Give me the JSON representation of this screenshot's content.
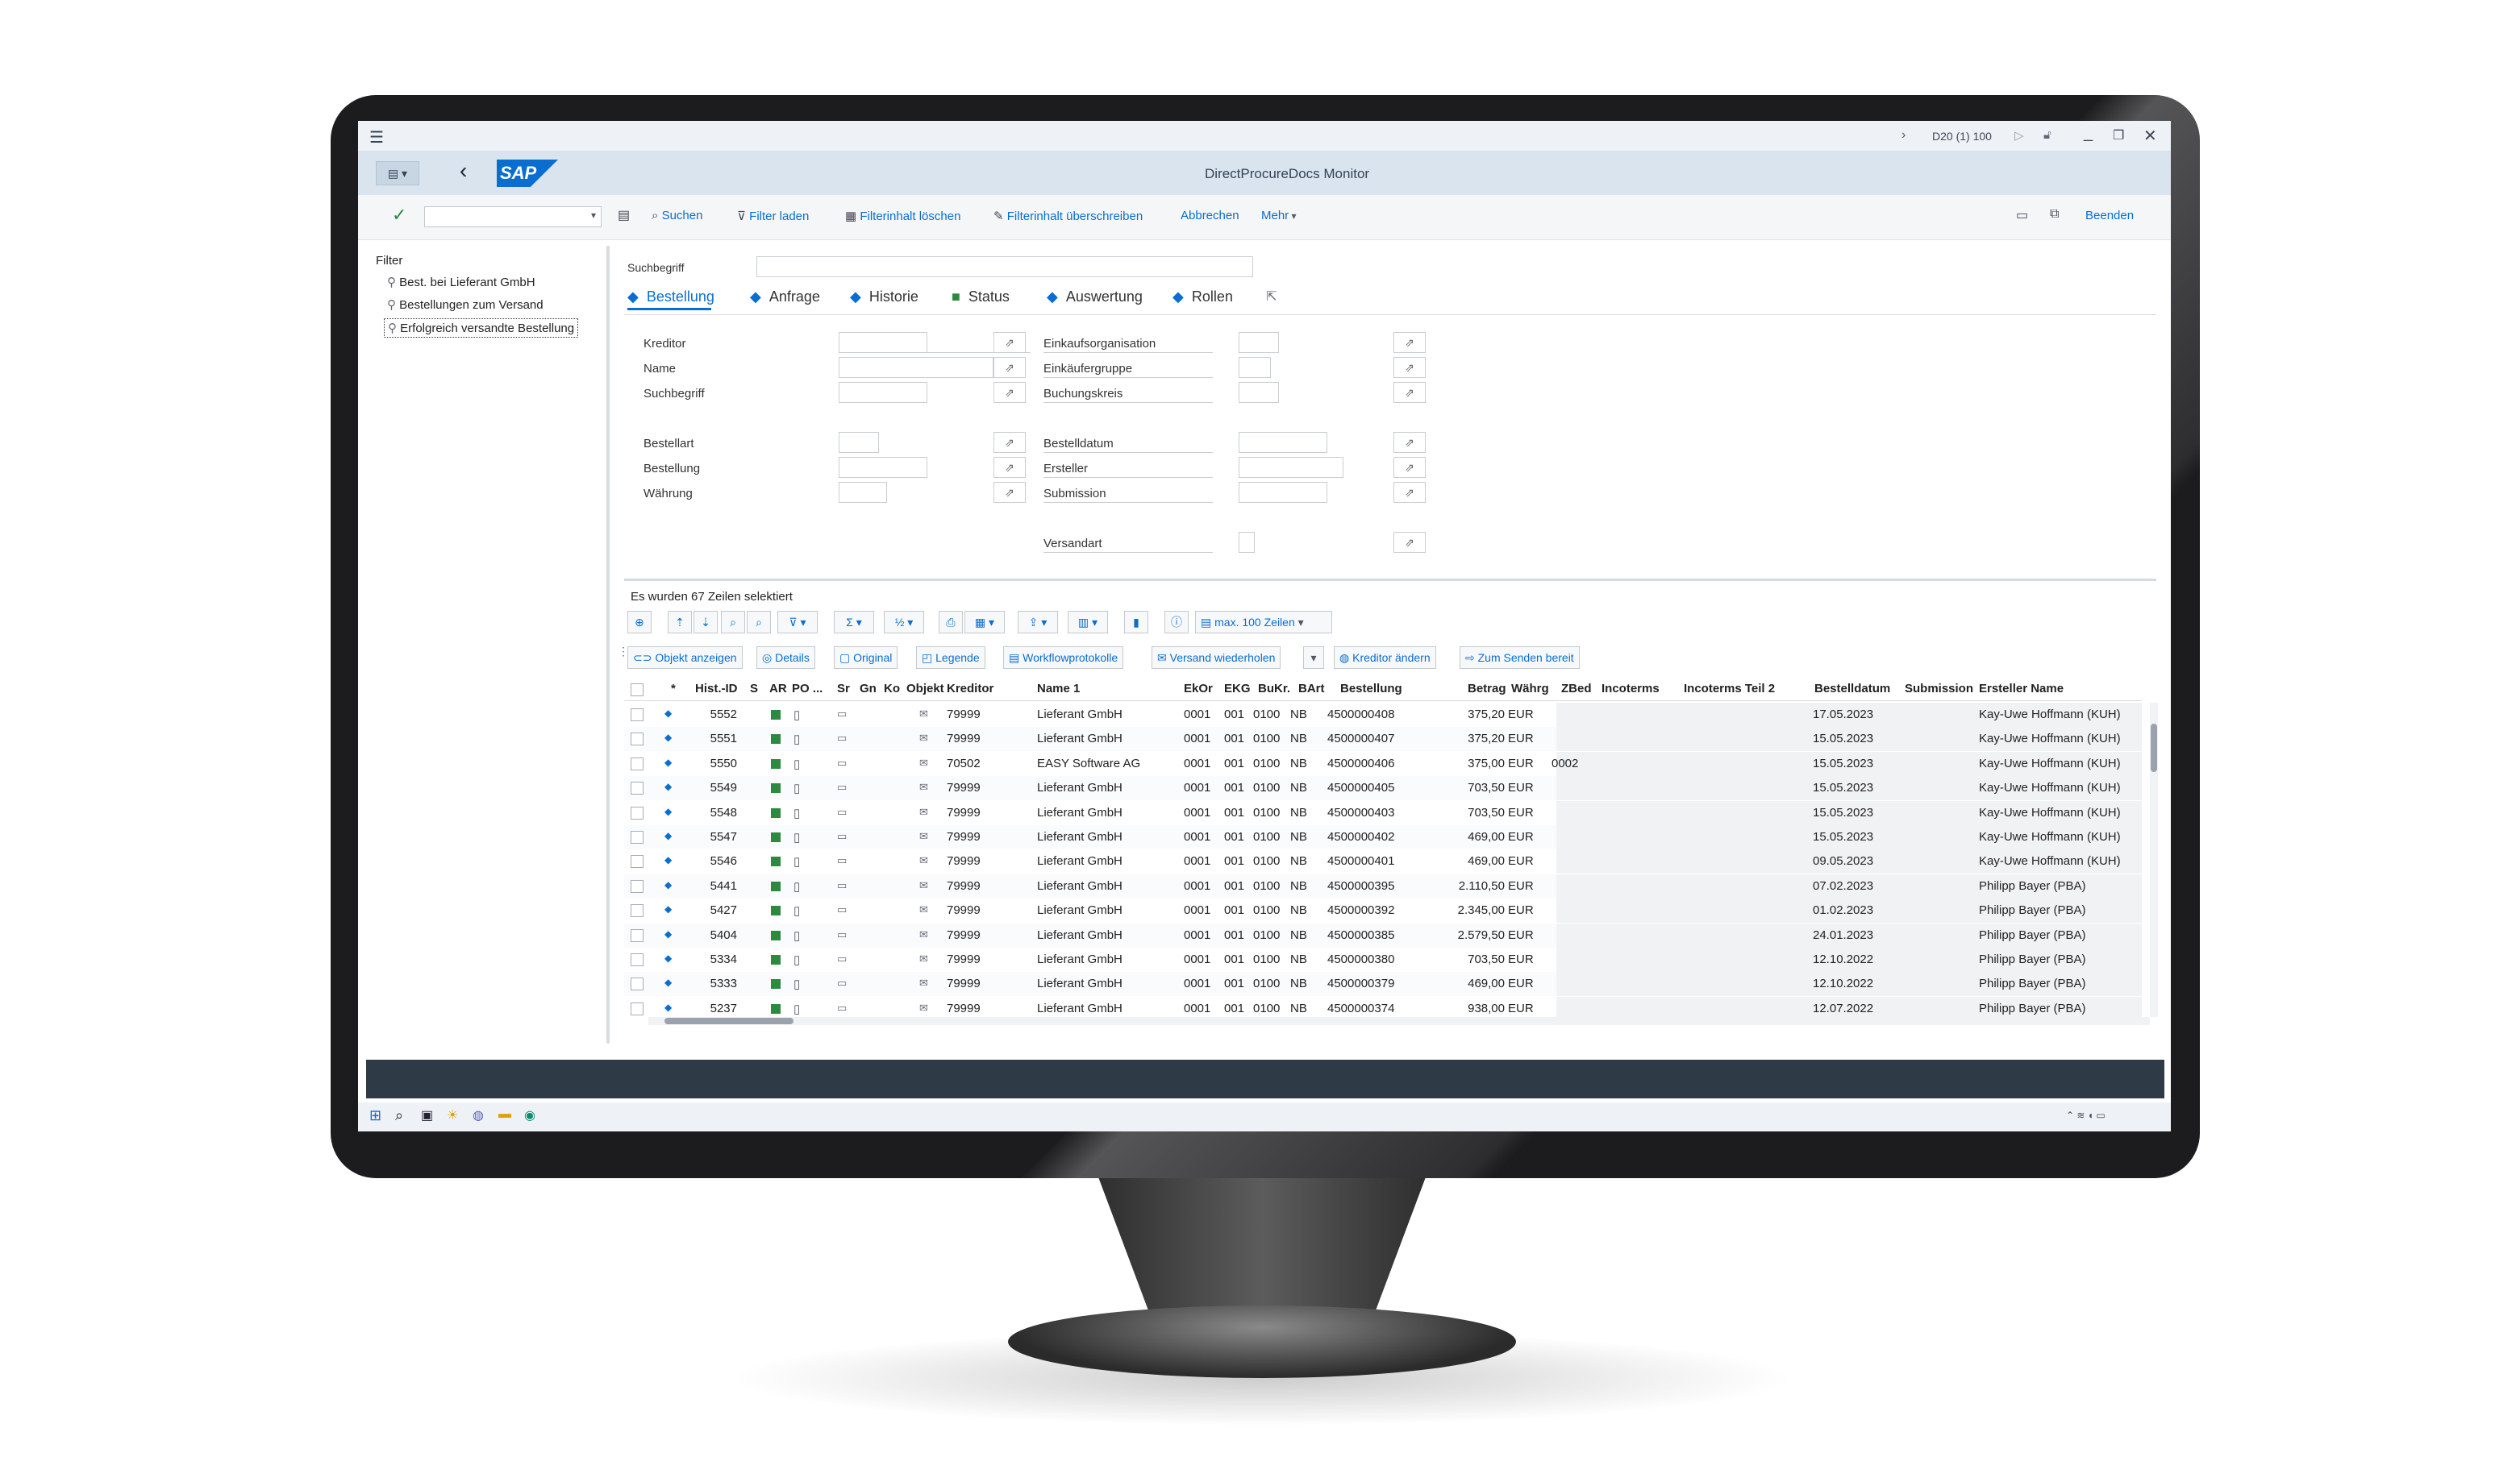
{
  "window": {
    "session": "D20 (1) 100",
    "title": "DirectProcureDocs Monitor",
    "logo": "SAP"
  },
  "toolbar": {
    "items": [
      "Suchen",
      "Filter laden",
      "Filterinhalt löschen",
      "Filterinhalt überschreiben",
      "Abbrechen",
      "Mehr"
    ],
    "exit": "Beenden"
  },
  "filter": {
    "title": "Filter",
    "items": [
      "Best. bei Lieferant GmbH",
      "Bestellungen zum Versand",
      "Erfolgreich versandte Bestellung"
    ]
  },
  "search": {
    "label": "Suchbegriff",
    "value": ""
  },
  "tabs": [
    {
      "label": "Bestellung",
      "marker": "◆",
      "active": true
    },
    {
      "label": "Anfrage",
      "marker": "◆"
    },
    {
      "label": "Historie",
      "marker": "◆"
    },
    {
      "label": "Status",
      "marker": "■"
    },
    {
      "label": "Auswertung",
      "marker": "◆"
    },
    {
      "label": "Rollen",
      "marker": "◆"
    }
  ],
  "form": {
    "left": [
      "Kreditor",
      "Name",
      "Suchbegriff",
      "Bestellart",
      "Bestellung",
      "Währung"
    ],
    "right": [
      "Einkaufsorganisation",
      "Einkäufergruppe",
      "Buchungskreis",
      "Bestelldatum",
      "Ersteller",
      "Submission",
      "Versandart"
    ]
  },
  "result": {
    "count_text": "Es wurden 67 Zeilen selektiert",
    "max_rows": "max. 100 Zeilen",
    "actions": [
      "Objekt anzeigen",
      "Details",
      "Original",
      "Legende",
      "Workflowprotokolle",
      "Versand wiederholen",
      "Kreditor ändern",
      "Zum Senden bereit"
    ]
  },
  "table": {
    "columns": [
      "*",
      "Hist.-ID",
      "S",
      "AR",
      "PO ...",
      "Sr",
      "Gn",
      "Ko",
      "Objekt",
      "Kreditor",
      "Name 1",
      "EkOr",
      "EKG",
      "BuKr.",
      "BArt",
      "Bestellung",
      "Betrag",
      "Währg",
      "ZBed",
      "Incoterms",
      "Incoterms Teil 2",
      "Bestelldatum",
      "Submission",
      "Ersteller Name"
    ],
    "rows": [
      {
        "id": "5552",
        "kreditor": "79999",
        "name": "Lieferant GmbH",
        "ekor": "0001",
        "ekg": "001",
        "bukr": "0100",
        "bart": "NB",
        "bestellung": "4500000408",
        "betrag": "375,20",
        "waehrung": "EUR",
        "zbed": "",
        "datum": "17.05.2023",
        "ersteller": "Kay-Uwe Hoffmann (KUH)"
      },
      {
        "id": "5551",
        "kreditor": "79999",
        "name": "Lieferant GmbH",
        "ekor": "0001",
        "ekg": "001",
        "bukr": "0100",
        "bart": "NB",
        "bestellung": "4500000407",
        "betrag": "375,20",
        "waehrung": "EUR",
        "zbed": "",
        "datum": "15.05.2023",
        "ersteller": "Kay-Uwe Hoffmann (KUH)"
      },
      {
        "id": "5550",
        "kreditor": "70502",
        "name": "EASY Software AG",
        "ekor": "0001",
        "ekg": "001",
        "bukr": "0100",
        "bart": "NB",
        "bestellung": "4500000406",
        "betrag": "375,00",
        "waehrung": "EUR",
        "zbed": "0002",
        "datum": "15.05.2023",
        "ersteller": "Kay-Uwe Hoffmann (KUH)"
      },
      {
        "id": "5549",
        "kreditor": "79999",
        "name": "Lieferant GmbH",
        "ekor": "0001",
        "ekg": "001",
        "bukr": "0100",
        "bart": "NB",
        "bestellung": "4500000405",
        "betrag": "703,50",
        "waehrung": "EUR",
        "zbed": "",
        "datum": "15.05.2023",
        "ersteller": "Kay-Uwe Hoffmann (KUH)"
      },
      {
        "id": "5548",
        "kreditor": "79999",
        "name": "Lieferant GmbH",
        "ekor": "0001",
        "ekg": "001",
        "bukr": "0100",
        "bart": "NB",
        "bestellung": "4500000403",
        "betrag": "703,50",
        "waehrung": "EUR",
        "zbed": "",
        "datum": "15.05.2023",
        "ersteller": "Kay-Uwe Hoffmann (KUH)"
      },
      {
        "id": "5547",
        "kreditor": "79999",
        "name": "Lieferant GmbH",
        "ekor": "0001",
        "ekg": "001",
        "bukr": "0100",
        "bart": "NB",
        "bestellung": "4500000402",
        "betrag": "469,00",
        "waehrung": "EUR",
        "zbed": "",
        "datum": "15.05.2023",
        "ersteller": "Kay-Uwe Hoffmann (KUH)"
      },
      {
        "id": "5546",
        "kreditor": "79999",
        "name": "Lieferant GmbH",
        "ekor": "0001",
        "ekg": "001",
        "bukr": "0100",
        "bart": "NB",
        "bestellung": "4500000401",
        "betrag": "469,00",
        "waehrung": "EUR",
        "zbed": "",
        "datum": "09.05.2023",
        "ersteller": "Kay-Uwe Hoffmann (KUH)"
      },
      {
        "id": "5441",
        "kreditor": "79999",
        "name": "Lieferant GmbH",
        "ekor": "0001",
        "ekg": "001",
        "bukr": "0100",
        "bart": "NB",
        "bestellung": "4500000395",
        "betrag": "2.110,50",
        "waehrung": "EUR",
        "zbed": "",
        "datum": "07.02.2023",
        "ersteller": "Philipp Bayer (PBA)"
      },
      {
        "id": "5427",
        "kreditor": "79999",
        "name": "Lieferant GmbH",
        "ekor": "0001",
        "ekg": "001",
        "bukr": "0100",
        "bart": "NB",
        "bestellung": "4500000392",
        "betrag": "2.345,00",
        "waehrung": "EUR",
        "zbed": "",
        "datum": "01.02.2023",
        "ersteller": "Philipp Bayer (PBA)"
      },
      {
        "id": "5404",
        "kreditor": "79999",
        "name": "Lieferant GmbH",
        "ekor": "0001",
        "ekg": "001",
        "bukr": "0100",
        "bart": "NB",
        "bestellung": "4500000385",
        "betrag": "2.579,50",
        "waehrung": "EUR",
        "zbed": "",
        "datum": "24.01.2023",
        "ersteller": "Philipp Bayer (PBA)"
      },
      {
        "id": "5334",
        "kreditor": "79999",
        "name": "Lieferant GmbH",
        "ekor": "0001",
        "ekg": "001",
        "bukr": "0100",
        "bart": "NB",
        "bestellung": "4500000380",
        "betrag": "703,50",
        "waehrung": "EUR",
        "zbed": "",
        "datum": "12.10.2022",
        "ersteller": "Philipp Bayer (PBA)"
      },
      {
        "id": "5333",
        "kreditor": "79999",
        "name": "Lieferant GmbH",
        "ekor": "0001",
        "ekg": "001",
        "bukr": "0100",
        "bart": "NB",
        "bestellung": "4500000379",
        "betrag": "469,00",
        "waehrung": "EUR",
        "zbed": "",
        "datum": "12.10.2022",
        "ersteller": "Philipp Bayer (PBA)"
      },
      {
        "id": "5237",
        "kreditor": "79999",
        "name": "Lieferant GmbH",
        "ekor": "0001",
        "ekg": "001",
        "bukr": "0100",
        "bart": "NB",
        "bestellung": "4500000374",
        "betrag": "938,00",
        "waehrung": "EUR",
        "zbed": "",
        "datum": "12.07.2022",
        "ersteller": "Philipp Bayer (PBA)"
      }
    ]
  },
  "colors": {
    "accent": "#0a6ed1",
    "status_green": "#2b8a3e",
    "header_blue": "#dae4ee",
    "statusbar": "#2e3a46"
  }
}
